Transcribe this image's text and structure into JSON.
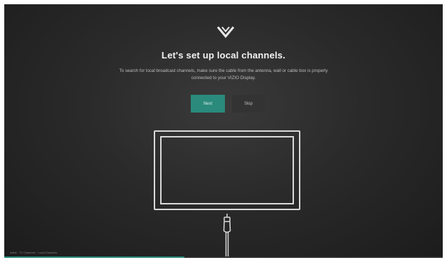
{
  "setup": {
    "title": "Let's set up local channels.",
    "description": "To search for local broadcast channels, make sure the cable from the antenna, wall or cable box is properly connected to your VIZIO Display.",
    "next_label": "Next",
    "skip_label": "Skip"
  },
  "logo": {
    "icon": "vizio-v-logo-icon"
  },
  "illustration": {
    "icons": [
      "tv-outline-icon",
      "coax-cable-icon"
    ]
  },
  "footer": {
    "breadcrumb": "Initial · TV Channels · Local Channels",
    "progress_fraction": 0.41
  },
  "colors": {
    "accent": "#2a8a7b",
    "background": "#2a2a2a",
    "text": "#f2f2f2",
    "muted_text": "#bdbdbd"
  }
}
